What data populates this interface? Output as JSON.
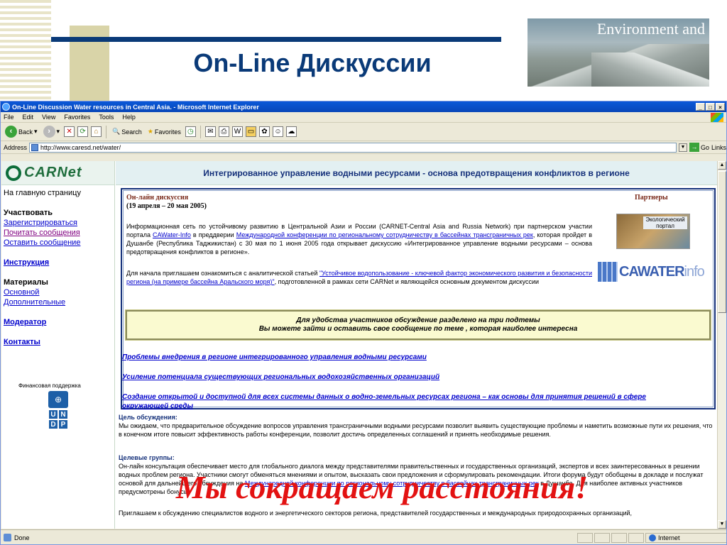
{
  "slide": {
    "title": "On-Line Дискуссии",
    "banner_text": "Environment and",
    "overlay": "Мы сокращаем расстояния!"
  },
  "browser": {
    "title": "On-Line Discussion Water resources in Central Asia. - Microsoft Internet Explorer",
    "menu": [
      "File",
      "Edit",
      "View",
      "Favorites",
      "Tools",
      "Help"
    ],
    "toolbar": {
      "back": "Back",
      "search": "Search",
      "favorites": "Favorites"
    },
    "address_label": "Address",
    "url": "http://www.caresd.net/water/",
    "go": "Go",
    "links": "Links",
    "status": "Done",
    "zone": "Internet"
  },
  "page": {
    "logo": "CARNet",
    "header": "Интегрированное управление водными ресурсами - основа предотвращения конфликтов в регионе",
    "nav": {
      "home": "На главную страницу",
      "participate": "Участвовать",
      "register": "Зарегистрироваться",
      "read": "Почитать сообщения",
      "leave": "Оставить сообщение",
      "instruction": "Инструкция",
      "materials": "Материалы",
      "main_mat": "Основной",
      "extra_mat": "Дополнительные",
      "moderator": "Модератор",
      "contacts": "Контакты"
    },
    "financial": "Финансовая поддержка",
    "undp_letters": [
      "U",
      "N",
      "D",
      "P"
    ],
    "box": {
      "label": "Он-лайн дискуссия",
      "date": "(19 апреля – 20 мая 2005)",
      "partners": "Партнеры",
      "eco_portal": "Экологический портал",
      "cawater_a": "CAWATER",
      "cawater_b": "info",
      "p1_a": "Информационная сеть по устойчивому развитию в Центральной Азии и России (CARNET-Central Asia and Russia Network) при партнерском участии портала ",
      "p1_link1": "CAWater-Info",
      "p1_b": " в преддверии ",
      "p1_link2": "Международной конференции по региональному сотрудничеству в бассейнах трансграничных рек",
      "p1_c": ", которая пройдет в Душанбе (Республика Таджикистан) с 30 мая по 1 июня 2005 года открывает дискуссию «Интегрированное управление водными ресурсами – основа предотвращения конфликтов в регионе».",
      "p2_a": "Для начала приглашаем ознакомиться с аналитической статьей ",
      "p2_link": "\"Устойчивое водопользование - ключевой фактор экономического развития и безопасности региона (на примере бассейна Аральского моря)\"",
      "p2_b": ", подготовленной в рамках сети CARNet и являющейся основным документом дискуссии",
      "notice_1": "Для удобства участников обсуждение разделено на три подтемы",
      "notice_2": "Вы можете зайти и оставить свое сообщение по теме , которая наиболее интересна",
      "topic_a": "Проблемы внедрения в регионе интегрированного управления водными ресурсами",
      "topic_b": "Усиление потенциала существующих региональных водохозяйственных организаций",
      "topic_c": "Создание открытой и доступной для всех системы данных о водно-земельных ресурсах региона – как основы для принятия решений в сфере окружающей среды"
    },
    "goal_h": "Цель обсуждения:",
    "goal_text": "Мы ожидаем, что предварительное обсуждение вопросов управления трансграничными водными ресурсами позволит выявить существующие проблемы и наметить возможные пути их решения, что в конечном итоге повысит эффективность работы конференции, позволит достичь определенных соглашений и принять необходимые решения.",
    "groups_h": "Целевые группы:",
    "groups_a": "Он-лайн консультация обеспечивает место для глобального диалога между представителями правительственных и государственных организаций, экспертов и всех заинтересованных в решении водных проблем региона. Участники смогут обменяться мнениями и опытом, высказать свои предложения и сформулировать рекомендации. Итоги форума будут обобщены в докладе и послужат основой для дальнейшего обсуждения на ",
    "groups_link": "Международной конференции по региональному сотрудничеству в бассейнах трансграничных рек",
    "groups_b": " в Душанбе. Для наиболее активных участников предусмотрены бонусы",
    "invite": "Приглашаем к обсуждению специалистов водного и энергетического секторов региона, представителей государственных и международных природоохранных организаций,"
  }
}
